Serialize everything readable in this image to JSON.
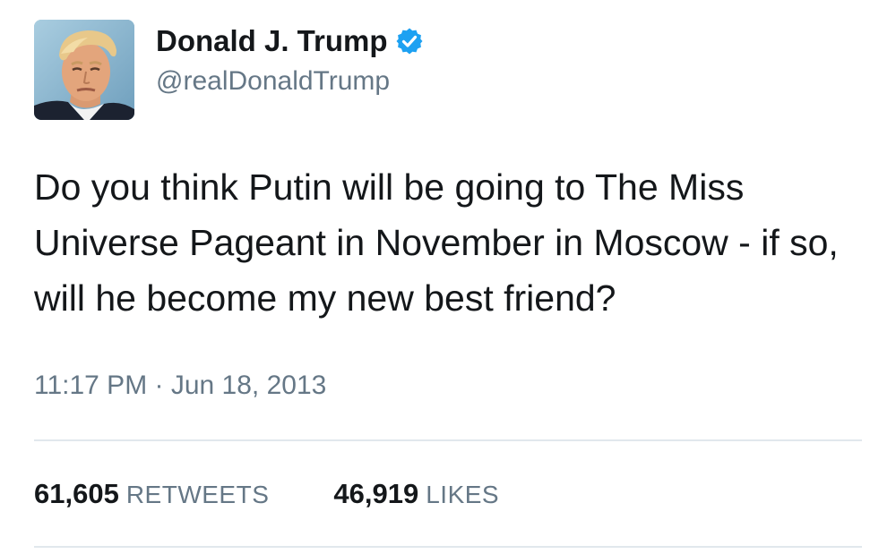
{
  "tweet": {
    "author": {
      "display_name": "Donald J. Trump",
      "handle": "@realDonaldTrump",
      "verified": true,
      "verified_badge_color": "#1da1f2"
    },
    "text": "Do you think Putin will be going to The Miss Universe Pageant in November in Moscow - if so, will he become my new best friend?",
    "timestamp": "11:17 PM · Jun 18, 2013",
    "stats": {
      "retweets_count": "61,605",
      "retweets_label": "RETWEETS",
      "likes_count": "46,919",
      "likes_label": "LIKES"
    }
  },
  "colors": {
    "primary_text": "#14171a",
    "secondary_text": "#657786",
    "divider": "#e1e8ed"
  }
}
